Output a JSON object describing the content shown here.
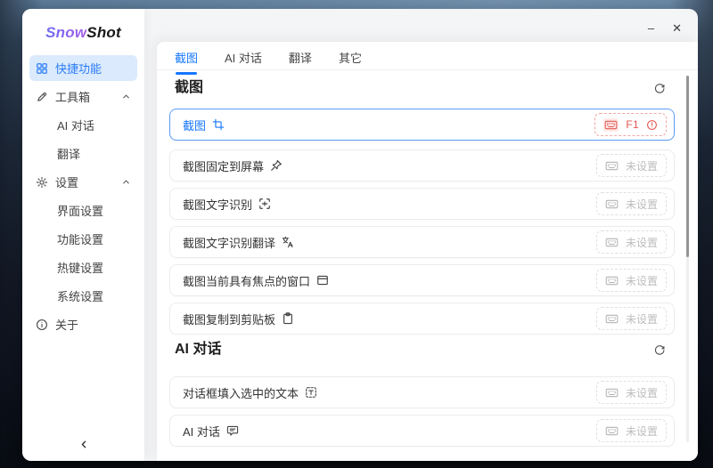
{
  "window": {
    "app_name": "SnowShot",
    "controls": {
      "minimize": "–",
      "close": "✕"
    }
  },
  "sidebar": {
    "logo": {
      "part1": "Snow",
      "part2": "Shot"
    },
    "items": [
      {
        "label": "快捷功能",
        "icon": "grid-icon",
        "active": true
      },
      {
        "label": "工具箱",
        "icon": "toolbox-pen-icon",
        "expanded": true
      },
      {
        "label": "AI 对话",
        "indent": true
      },
      {
        "label": "翻译",
        "indent": true
      },
      {
        "label": "设置",
        "icon": "gear-icon",
        "expanded": true
      },
      {
        "label": "界面设置",
        "indent": true
      },
      {
        "label": "功能设置",
        "indent": true
      },
      {
        "label": "热键设置",
        "indent": true
      },
      {
        "label": "系统设置",
        "indent": true
      },
      {
        "label": "关于",
        "icon": "info-icon"
      }
    ],
    "collapse_icon": "chevron-left-icon"
  },
  "main": {
    "tabs": [
      {
        "label": "截图",
        "active": true
      },
      {
        "label": "AI 对话"
      },
      {
        "label": "翻译"
      },
      {
        "label": "其它"
      }
    ],
    "sections": [
      {
        "title": "截图",
        "action_icon": "refresh-icon"
      },
      {
        "title": "AI 对话",
        "action_icon": "refresh-icon"
      }
    ],
    "rows": [
      {
        "label": "截图",
        "icon": "screenshot-crop-icon",
        "shortcut": "F1",
        "state": "active",
        "badge_icons": [
          "keyboard-icon",
          "warning-circle-icon"
        ]
      },
      {
        "label": "截图固定到屏幕",
        "icon": "pin-icon",
        "status": "未设置"
      },
      {
        "label": "截图文字识别",
        "icon": "ocr-scan-icon",
        "status": "未设置"
      },
      {
        "label": "截图文字识别翻译",
        "icon": "ocr-translate-icon",
        "status": "未设置"
      },
      {
        "label": "截图当前具有焦点的窗口",
        "icon": "focused-window-icon",
        "status": "未设置"
      },
      {
        "label": "截图复制到剪贴板",
        "icon": "clipboard-icon",
        "status": "未设置"
      },
      {
        "label": "对话框填入选中的文本",
        "icon": "text-insert-icon",
        "status": "未设置"
      },
      {
        "label": "AI 对话",
        "icon": "chat-bubble-icon",
        "status": "未设置"
      }
    ]
  },
  "colors": {
    "accent_blue": "#1677ff",
    "active_row_border": "#5c9cf5",
    "danger_red": "#e05752",
    "danger_border": "#f2a8a3",
    "status_gray": "#bdbdbd",
    "sidebar_active_bg": "#dbeafc",
    "logo_purple": "#8a5cf0"
  }
}
